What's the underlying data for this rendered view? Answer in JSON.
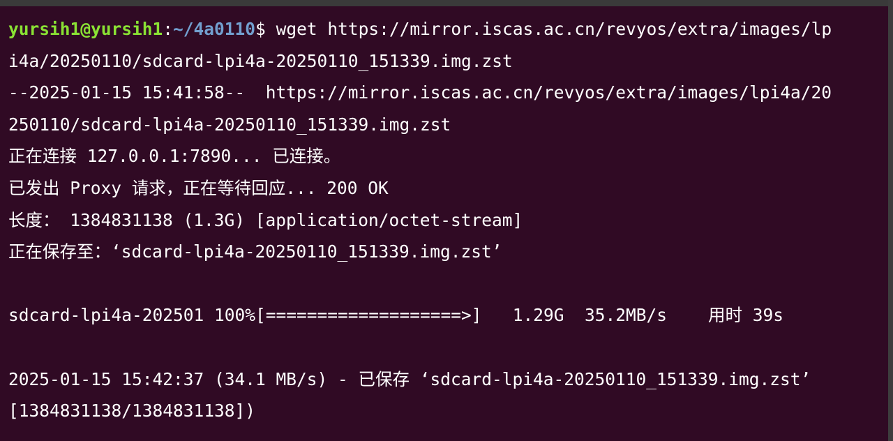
{
  "prompt": {
    "user_host": "yursih1@yursih1",
    "separator": ":",
    "path": "~/4a0110",
    "symbol": "$ "
  },
  "command_first": "wget https://mirror.iscas.ac.cn/revyos/extra/images/lp",
  "output_lines": [
    "i4a/20250110/sdcard-lpi4a-20250110_151339.img.zst",
    "--2025-01-15 15:41:58--  https://mirror.iscas.ac.cn/revyos/extra/images/lpi4a/20",
    "250110/sdcard-lpi4a-20250110_151339.img.zst",
    "正在连接 127.0.0.1:7890... 已连接。",
    "已发出 Proxy 请求，正在等待回应... 200 OK",
    "长度： 1384831138 (1.3G) [application/octet-stream]",
    "正在保存至：‘sdcard-lpi4a-20250110_151339.img.zst’",
    "",
    "sdcard-lpi4a-202501 100%[===================>]   1.29G  35.2MB/s    用时 39s",
    "",
    "2025-01-15 15:42:37 (34.1 MB/s) - 已保存 ‘sdcard-lpi4a-20250110_151339.img.zst’",
    "[1384831138/1384831138])"
  ],
  "download": {
    "file": "sdcard-lpi4a-202501",
    "progress_percent": 100
  },
  "colors": {
    "background": "#300a24",
    "foreground": "#ffffff",
    "prompt_user": "#8ae234",
    "prompt_path": "#729fcf"
  }
}
